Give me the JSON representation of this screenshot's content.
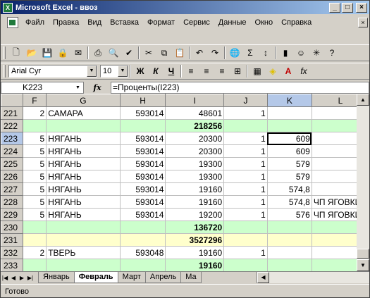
{
  "window": {
    "title": "Microsoft Excel - ввоз"
  },
  "menu": [
    "Файл",
    "Правка",
    "Вид",
    "Вставка",
    "Формат",
    "Сервис",
    "Данные",
    "Окно",
    "Справка"
  ],
  "format": {
    "font": "Arial Cyr",
    "size": "10",
    "bold": "Ж",
    "italic": "К",
    "underline": "Ч"
  },
  "formula_bar": {
    "cell": "K223",
    "fx": "fx",
    "formula": "=Проценты(I223)"
  },
  "columns": [
    "F",
    "G",
    "H",
    "I",
    "J",
    "K",
    "L"
  ],
  "active_column": "K",
  "rows": [
    {
      "num": "221",
      "f": "2",
      "g": "САМАРА",
      "h": "593014",
      "i": "48601",
      "j": "1",
      "k": "",
      "l": "",
      "kind": ""
    },
    {
      "num": "222",
      "f": "",
      "g": "",
      "h": "",
      "i": "218256",
      "j": "",
      "k": "",
      "l": "",
      "kind": "green"
    },
    {
      "num": "223",
      "f": "5",
      "g": "НЯГАНЬ",
      "h": "593014",
      "i": "20300",
      "j": "1",
      "k": "609",
      "l": "",
      "kind": "active"
    },
    {
      "num": "224",
      "f": "5",
      "g": "НЯГАНЬ",
      "h": "593014",
      "i": "20300",
      "j": "1",
      "k": "609",
      "l": "",
      "kind": ""
    },
    {
      "num": "225",
      "f": "5",
      "g": "НЯГАНЬ",
      "h": "593014",
      "i": "19300",
      "j": "1",
      "k": "579",
      "l": "",
      "kind": ""
    },
    {
      "num": "226",
      "f": "5",
      "g": "НЯГАНЬ",
      "h": "593014",
      "i": "19300",
      "j": "1",
      "k": "579",
      "l": "",
      "kind": ""
    },
    {
      "num": "227",
      "f": "5",
      "g": "НЯГАНЬ",
      "h": "593014",
      "i": "19160",
      "j": "1",
      "k": "574,8",
      "l": "",
      "kind": ""
    },
    {
      "num": "228",
      "f": "5",
      "g": "НЯГАНЬ",
      "h": "593014",
      "i": "19160",
      "j": "1",
      "k": "574,8",
      "l": "ЧП ЯГОВКИН",
      "kind": ""
    },
    {
      "num": "229",
      "f": "5",
      "g": "НЯГАНЬ",
      "h": "593014",
      "i": "19200",
      "j": "1",
      "k": "576",
      "l": "ЧП ЯГОВКИН",
      "kind": ""
    },
    {
      "num": "230",
      "f": "",
      "g": "",
      "h": "",
      "i": "136720",
      "j": "",
      "k": "",
      "l": "",
      "kind": "green"
    },
    {
      "num": "231",
      "f": "",
      "g": "",
      "h": "",
      "i": "3527296",
      "j": "",
      "k": "",
      "l": "",
      "kind": "yellow"
    },
    {
      "num": "232",
      "f": "2",
      "g": "ТВЕРЬ",
      "h": "593048",
      "i": "19160",
      "j": "1",
      "k": "",
      "l": "",
      "kind": ""
    },
    {
      "num": "233",
      "f": "",
      "g": "",
      "h": "",
      "i": "19160",
      "j": "",
      "k": "",
      "l": "",
      "kind": "green"
    }
  ],
  "tabs": [
    "Январь",
    "Февраль",
    "Март",
    "Апрель",
    "Ма"
  ],
  "active_tab": "Февраль",
  "status": "Готово"
}
